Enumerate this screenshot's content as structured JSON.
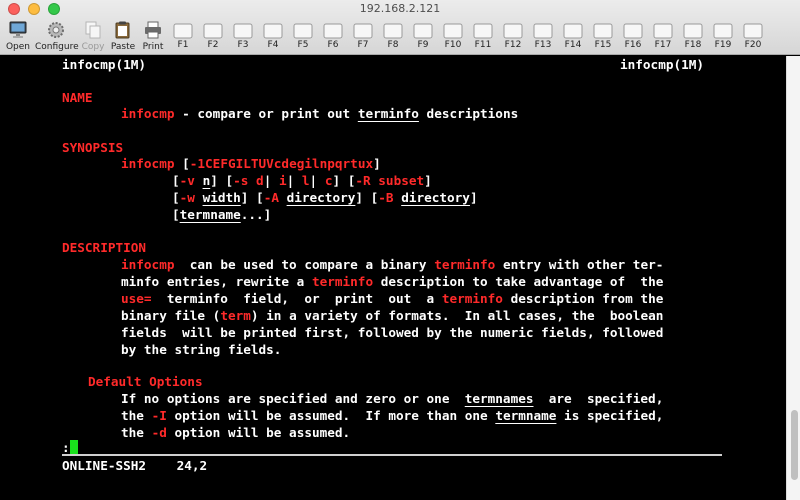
{
  "window": {
    "title": "192.168.2.121"
  },
  "toolbar": {
    "open": "Open",
    "configure": "Configure",
    "copy": "Copy",
    "paste": "Paste",
    "print": "Print",
    "fkeys": [
      "F1",
      "F2",
      "F3",
      "F4",
      "F5",
      "F6",
      "F7",
      "F8",
      "F9",
      "F10",
      "F11",
      "F12",
      "F13",
      "F14",
      "F15",
      "F16",
      "F17",
      "F18",
      "F19",
      "F20"
    ]
  },
  "terminal": {
    "header_left": "infocmp(1M)",
    "header_right": "infocmp(1M)",
    "name_heading": "NAME",
    "name_cmd": "infocmp",
    "name_dash": " - compare or print out ",
    "name_terminfo": "terminfo",
    "name_rest": " descriptions",
    "synopsis_heading": "SYNOPSIS",
    "syn1_cmd": "infocmp",
    "syn1_sp": " [",
    "syn1_flags": "-1CEFGILTUVcdegilnpqrtux",
    "syn1_end": "]",
    "syn2_a": "[",
    "syn2_v": "-v",
    "syn2_sp": " ",
    "syn2_n": "n",
    "syn2_b": "] [",
    "syn2_s": "-s d",
    "syn2_p1": "| ",
    "syn2_i": "i",
    "syn2_p2": "| ",
    "syn2_l": "l",
    "syn2_p3": "| ",
    "syn2_c": "c",
    "syn2_c2": "] [",
    "syn2_R": "-R subset",
    "syn2_end": "]",
    "syn3_a": "[",
    "syn3_w": "-w",
    "syn3_sp": " ",
    "syn3_width": "width",
    "syn3_b": "] [",
    "syn3_A": "-A",
    "syn3_sp2": " ",
    "syn3_dir1": "directory",
    "syn3_c": "] [",
    "syn3_B": "-B",
    "syn3_sp3": " ",
    "syn3_dir2": "directory",
    "syn3_end": "]",
    "syn4_a": "[",
    "syn4_tn": "termname",
    "syn4_end": "...]",
    "description_heading": "DESCRIPTION",
    "d1_cmd": "infocmp",
    "d1_a": "  can be used to compare a binary ",
    "d1_t": "terminfo",
    "d1_b": " entry with other ter-",
    "d2_a": "minfo entries, rewrite a ",
    "d2_t": "terminfo",
    "d2_b": " description to take advantage of  the",
    "d3_use": "use=",
    "d3_a": "  terminfo  field,  or  print  out  a ",
    "d3_t": "terminfo",
    "d3_b": " description from the",
    "d4_a": "binary file (",
    "d4_term": "term",
    "d4_b": ") in a variety of formats.  In all cases, the  boolean",
    "d5": "fields  will be printed first, followed by the numeric fields, followed",
    "d6": "by the string fields.",
    "default_heading": "Default Options",
    "o1_a": "If no options are specified and zero or one  ",
    "o1_tn": "termnames",
    "o1_b": "  are  specified,",
    "o2_a": "the ",
    "o2_I": "-I",
    "o2_b": " option will be assumed.  If more than one ",
    "o2_tn": "termname",
    "o2_c": " is specified,",
    "o3_a": "the ",
    "o3_d": "-d",
    "o3_b": " option will be assumed.",
    "prompt": ":",
    "status": "ONLINE-SSH2    24,2"
  },
  "colors": {
    "accent_red": "#ff2a2a",
    "cursor_green": "#19e01c",
    "background": "#000000"
  }
}
